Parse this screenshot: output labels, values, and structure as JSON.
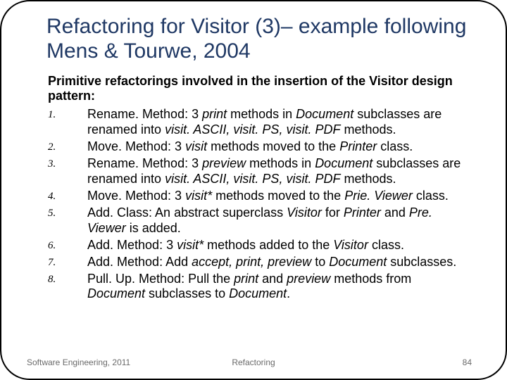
{
  "title": "Refactoring for Visitor (3)–  example following Mens & Tourwe, 2004",
  "intro": "Primitive refactorings involved in the insertion of the Visitor design pattern:",
  "items": [
    "Rename. Method: 3 <i>print</i> methods in <i>Document</i> subclasses are renamed into <i>visit. ASCII, visit. PS, visit. PDF</i> methods.",
    "Move. Method: 3 <i>visit</i> methods moved to the <i>Printer</i> class.",
    "Rename. Method: 3 <i>preview</i> methods in <i>Document</i> subclasses are renamed into <i>visit. ASCII, visit. PS, visit. PDF</i> methods.",
    "Move. Method: 3 <i>visit*</i> methods moved to the <i>Prie. Viewer</i> class.",
    "Add. Class: An abstract superclass <i>Visitor</i> for <i>Printer</i> and <i>Pre. Viewer</i> is added.",
    "Add. Method: 3 <i>visit*</i> methods added to the <i>Visitor</i> class.",
    "Add. Method: Add <i>accept, print, preview</i> to <i>Document</i> subclasses.",
    "Pull. Up. Method: Pull the <i>print</i> and <i>preview</i> methods from <i>Document</i> subclasses to <i>Document</i>."
  ],
  "footer": {
    "left": "Software Engineering, 2011",
    "center": "Refactoring",
    "right": "84"
  }
}
